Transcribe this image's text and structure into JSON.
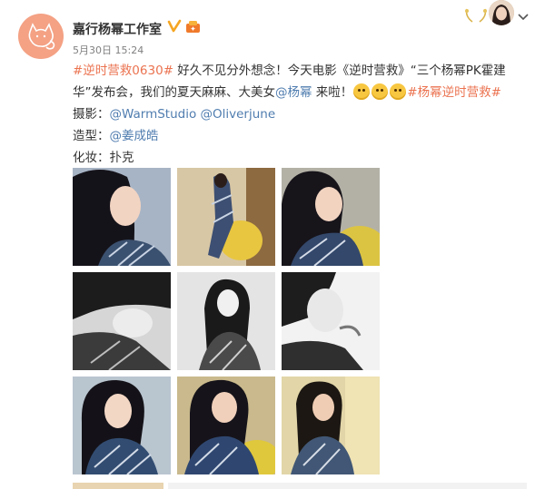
{
  "post": {
    "author": "嘉行杨幂工作室",
    "time": "5月30日 15:24",
    "line1": {
      "tag1": "#逆时营救0630#",
      "text1": " 好久不见分外想念！今天电影《逆时营救》“三个杨幂PK霍建",
      "text2": "华”发布会，我们的夏天麻麻、大美女",
      "mention": "@杨幂",
      "text3": " 来啦！",
      "tag2": "#杨幂逆时营救#"
    },
    "credits": {
      "photo_label": "摄影：",
      "photo_value": "@WarmStudio @Oliverjune",
      "styling_label": "造型：",
      "styling_value": "@姜成皓",
      "makeup_label": "化妆：",
      "makeup_value": "扑克"
    }
  },
  "colors": {
    "link": "#507daf",
    "tag": "#eb7350",
    "avatar_bg": "#f4a184",
    "verified": "#f5a623"
  },
  "icons": {
    "verified": "verified-v-icon",
    "medal": "member-medal-icon",
    "menu": "chevron-down-icon"
  },
  "photos": [
    {
      "name": "photo-1",
      "tone": "color"
    },
    {
      "name": "photo-2",
      "tone": "color"
    },
    {
      "name": "photo-3",
      "tone": "color"
    },
    {
      "name": "photo-4",
      "tone": "bw"
    },
    {
      "name": "photo-5",
      "tone": "bw"
    },
    {
      "name": "photo-6",
      "tone": "bw"
    },
    {
      "name": "photo-7",
      "tone": "color"
    },
    {
      "name": "photo-8",
      "tone": "color"
    },
    {
      "name": "photo-9",
      "tone": "color"
    }
  ]
}
